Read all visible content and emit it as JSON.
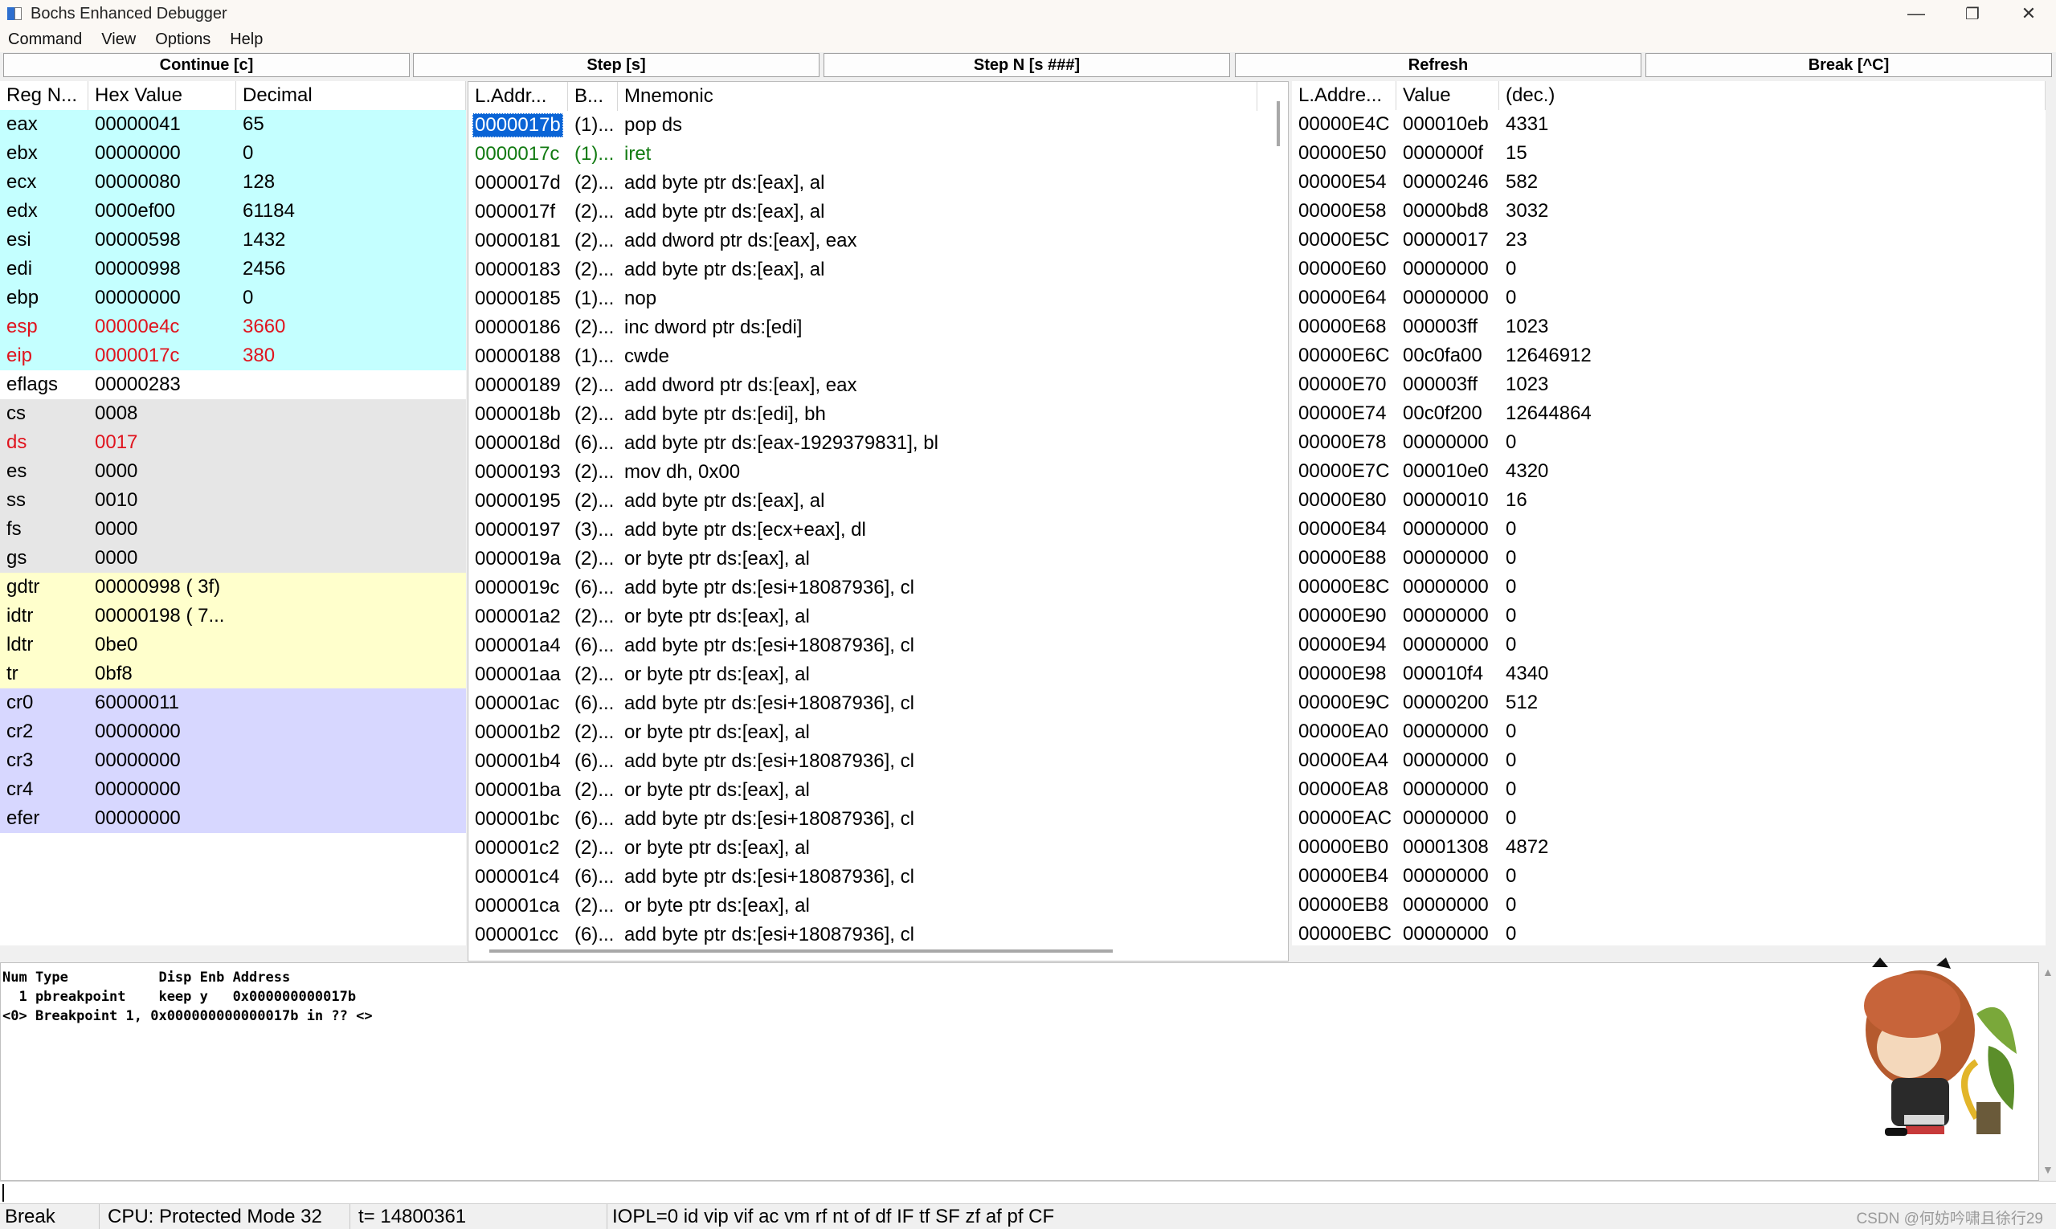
{
  "window": {
    "title": "Bochs Enhanced Debugger",
    "controls": {
      "minimize": "—",
      "restore": "❐",
      "close": "✕"
    }
  },
  "menu": [
    "Command",
    "View",
    "Options",
    "Help"
  ],
  "toolbar": {
    "continue": "Continue [c]",
    "step": "Step [s]",
    "step_n": "Step N [s ###]",
    "refresh": "Refresh",
    "break": "Break [^C]"
  },
  "registers": {
    "headers": [
      "Reg N...",
      "Hex Value",
      "Decimal"
    ],
    "rows": [
      {
        "name": "eax",
        "hex": "00000041",
        "dec": "65",
        "group": "gp",
        "changed": false
      },
      {
        "name": "ebx",
        "hex": "00000000",
        "dec": "0",
        "group": "gp",
        "changed": false
      },
      {
        "name": "ecx",
        "hex": "00000080",
        "dec": "128",
        "group": "gp",
        "changed": false
      },
      {
        "name": "edx",
        "hex": "0000ef00",
        "dec": "61184",
        "group": "gp",
        "changed": false
      },
      {
        "name": "esi",
        "hex": "00000598",
        "dec": "1432",
        "group": "gp",
        "changed": false
      },
      {
        "name": "edi",
        "hex": "00000998",
        "dec": "2456",
        "group": "gp",
        "changed": false
      },
      {
        "name": "ebp",
        "hex": "00000000",
        "dec": "0",
        "group": "gp",
        "changed": false
      },
      {
        "name": "esp",
        "hex": "00000e4c",
        "dec": "3660",
        "group": "gp",
        "changed": true
      },
      {
        "name": "eip",
        "hex": "0000017c",
        "dec": "380",
        "group": "gp",
        "changed": true
      },
      {
        "name": "eflags",
        "hex": "00000283",
        "dec": "",
        "group": "fl",
        "changed": false
      },
      {
        "name": "cs",
        "hex": "0008",
        "dec": "",
        "group": "seg",
        "changed": false
      },
      {
        "name": "ds",
        "hex": "0017",
        "dec": "",
        "group": "seg",
        "changed": true
      },
      {
        "name": "es",
        "hex": "0000",
        "dec": "",
        "group": "seg",
        "changed": false
      },
      {
        "name": "ss",
        "hex": "0010",
        "dec": "",
        "group": "seg",
        "changed": false
      },
      {
        "name": "fs",
        "hex": "0000",
        "dec": "",
        "group": "seg",
        "changed": false
      },
      {
        "name": "gs",
        "hex": "0000",
        "dec": "",
        "group": "seg",
        "changed": false
      },
      {
        "name": "gdtr",
        "hex": "00000998 ( 3f)",
        "dec": "",
        "group": "sys",
        "changed": false
      },
      {
        "name": "idtr",
        "hex": "00000198 ( 7...",
        "dec": "",
        "group": "sys",
        "changed": false
      },
      {
        "name": "ldtr",
        "hex": "0be0",
        "dec": "",
        "group": "sys",
        "changed": false
      },
      {
        "name": "tr",
        "hex": "0bf8",
        "dec": "",
        "group": "sys",
        "changed": false
      },
      {
        "name": "cr0",
        "hex": "60000011",
        "dec": "",
        "group": "cr",
        "changed": false
      },
      {
        "name": "cr2",
        "hex": "00000000",
        "dec": "",
        "group": "cr",
        "changed": false
      },
      {
        "name": "cr3",
        "hex": "00000000",
        "dec": "",
        "group": "cr",
        "changed": false
      },
      {
        "name": "cr4",
        "hex": "00000000",
        "dec": "",
        "group": "cr",
        "changed": false
      },
      {
        "name": "efer",
        "hex": "00000000",
        "dec": "",
        "group": "cr",
        "changed": false
      }
    ]
  },
  "disasm": {
    "headers": [
      "L.Addr...",
      "B...",
      "Mnemonic"
    ],
    "rows": [
      {
        "addr": "0000017b",
        "bytes": "(1)...",
        "mnem": "pop ds",
        "state": "selected"
      },
      {
        "addr": "0000017c",
        "bytes": "(1)...",
        "mnem": "iret",
        "state": "current"
      },
      {
        "addr": "0000017d",
        "bytes": "(2)...",
        "mnem": "add byte ptr ds:[eax], al",
        "state": ""
      },
      {
        "addr": "0000017f",
        "bytes": "(2)...",
        "mnem": "add byte ptr ds:[eax], al",
        "state": ""
      },
      {
        "addr": "00000181",
        "bytes": "(2)...",
        "mnem": "add dword ptr ds:[eax], eax",
        "state": ""
      },
      {
        "addr": "00000183",
        "bytes": "(2)...",
        "mnem": "add byte ptr ds:[eax], al",
        "state": ""
      },
      {
        "addr": "00000185",
        "bytes": "(1)...",
        "mnem": "nop",
        "state": ""
      },
      {
        "addr": "00000186",
        "bytes": "(2)...",
        "mnem": "inc dword ptr ds:[edi]",
        "state": ""
      },
      {
        "addr": "00000188",
        "bytes": "(1)...",
        "mnem": "cwde",
        "state": ""
      },
      {
        "addr": "00000189",
        "bytes": "(2)...",
        "mnem": "add dword ptr ds:[eax], eax",
        "state": ""
      },
      {
        "addr": "0000018b",
        "bytes": "(2)...",
        "mnem": "add byte ptr ds:[edi], bh",
        "state": ""
      },
      {
        "addr": "0000018d",
        "bytes": "(6)...",
        "mnem": "add byte ptr ds:[eax-1929379831], bl",
        "state": ""
      },
      {
        "addr": "00000193",
        "bytes": "(2)...",
        "mnem": "mov dh, 0x00",
        "state": ""
      },
      {
        "addr": "00000195",
        "bytes": "(2)...",
        "mnem": "add byte ptr ds:[eax], al",
        "state": ""
      },
      {
        "addr": "00000197",
        "bytes": "(3)...",
        "mnem": "add byte ptr ds:[ecx+eax], dl",
        "state": ""
      },
      {
        "addr": "0000019a",
        "bytes": "(2)...",
        "mnem": "or byte ptr ds:[eax], al",
        "state": ""
      },
      {
        "addr": "0000019c",
        "bytes": "(6)...",
        "mnem": "add byte ptr ds:[esi+18087936], cl",
        "state": ""
      },
      {
        "addr": "000001a2",
        "bytes": "(2)...",
        "mnem": "or byte ptr ds:[eax], al",
        "state": ""
      },
      {
        "addr": "000001a4",
        "bytes": "(6)...",
        "mnem": "add byte ptr ds:[esi+18087936], cl",
        "state": ""
      },
      {
        "addr": "000001aa",
        "bytes": "(2)...",
        "mnem": "or byte ptr ds:[eax], al",
        "state": ""
      },
      {
        "addr": "000001ac",
        "bytes": "(6)...",
        "mnem": "add byte ptr ds:[esi+18087936], cl",
        "state": ""
      },
      {
        "addr": "000001b2",
        "bytes": "(2)...",
        "mnem": "or byte ptr ds:[eax], al",
        "state": ""
      },
      {
        "addr": "000001b4",
        "bytes": "(6)...",
        "mnem": "add byte ptr ds:[esi+18087936], cl",
        "state": ""
      },
      {
        "addr": "000001ba",
        "bytes": "(2)...",
        "mnem": "or byte ptr ds:[eax], al",
        "state": ""
      },
      {
        "addr": "000001bc",
        "bytes": "(6)...",
        "mnem": "add byte ptr ds:[esi+18087936], cl",
        "state": ""
      },
      {
        "addr": "000001c2",
        "bytes": "(2)...",
        "mnem": "or byte ptr ds:[eax], al",
        "state": ""
      },
      {
        "addr": "000001c4",
        "bytes": "(6)...",
        "mnem": "add byte ptr ds:[esi+18087936], cl",
        "state": ""
      },
      {
        "addr": "000001ca",
        "bytes": "(2)...",
        "mnem": "or byte ptr ds:[eax], al",
        "state": ""
      },
      {
        "addr": "000001cc",
        "bytes": "(6)...",
        "mnem": "add byte ptr ds:[esi+18087936], cl",
        "state": ""
      }
    ]
  },
  "stack": {
    "headers": [
      "L.Addre...",
      "Value",
      "(dec.)"
    ],
    "rows": [
      {
        "addr": "00000E4C",
        "val": "000010eb",
        "dec": "4331"
      },
      {
        "addr": "00000E50",
        "val": "0000000f",
        "dec": "15"
      },
      {
        "addr": "00000E54",
        "val": "00000246",
        "dec": "582"
      },
      {
        "addr": "00000E58",
        "val": "00000bd8",
        "dec": "3032"
      },
      {
        "addr": "00000E5C",
        "val": "00000017",
        "dec": "23"
      },
      {
        "addr": "00000E60",
        "val": "00000000",
        "dec": "0"
      },
      {
        "addr": "00000E64",
        "val": "00000000",
        "dec": "0"
      },
      {
        "addr": "00000E68",
        "val": "000003ff",
        "dec": "1023"
      },
      {
        "addr": "00000E6C",
        "val": "00c0fa00",
        "dec": "12646912"
      },
      {
        "addr": "00000E70",
        "val": "000003ff",
        "dec": "1023"
      },
      {
        "addr": "00000E74",
        "val": "00c0f200",
        "dec": "12644864"
      },
      {
        "addr": "00000E78",
        "val": "00000000",
        "dec": "0"
      },
      {
        "addr": "00000E7C",
        "val": "000010e0",
        "dec": "4320"
      },
      {
        "addr": "00000E80",
        "val": "00000010",
        "dec": "16"
      },
      {
        "addr": "00000E84",
        "val": "00000000",
        "dec": "0"
      },
      {
        "addr": "00000E88",
        "val": "00000000",
        "dec": "0"
      },
      {
        "addr": "00000E8C",
        "val": "00000000",
        "dec": "0"
      },
      {
        "addr": "00000E90",
        "val": "00000000",
        "dec": "0"
      },
      {
        "addr": "00000E94",
        "val": "00000000",
        "dec": "0"
      },
      {
        "addr": "00000E98",
        "val": "000010f4",
        "dec": "4340"
      },
      {
        "addr": "00000E9C",
        "val": "00000200",
        "dec": "512"
      },
      {
        "addr": "00000EA0",
        "val": "00000000",
        "dec": "0"
      },
      {
        "addr": "00000EA4",
        "val": "00000000",
        "dec": "0"
      },
      {
        "addr": "00000EA8",
        "val": "00000000",
        "dec": "0"
      },
      {
        "addr": "00000EAC",
        "val": "00000000",
        "dec": "0"
      },
      {
        "addr": "00000EB0",
        "val": "00001308",
        "dec": "4872"
      },
      {
        "addr": "00000EB4",
        "val": "00000000",
        "dec": "0"
      },
      {
        "addr": "00000EB8",
        "val": "00000000",
        "dec": "0"
      },
      {
        "addr": "00000EBC",
        "val": "00000000",
        "dec": "0"
      }
    ]
  },
  "output": {
    "lines": [
      "Num Type           Disp Enb Address",
      "  1 pbreakpoint    keep y   0x000000000017b",
      "<0> Breakpoint 1, 0x000000000000017b in ?? <>"
    ]
  },
  "command_input": {
    "value": ""
  },
  "status": {
    "state": "Break",
    "cpu": "CPU: Protected Mode 32",
    "ticks": "t= 14800361",
    "flags": "IOPL=0 id vip vif ac vm rf nt of df IF tf SF zf af pf CF"
  },
  "watermark": "CSDN @何妨吟啸且徐行29",
  "colors": {
    "gp": "#c4ffff",
    "seg": "#e6e6e6",
    "sys": "#ffffcc",
    "cr": "#d7d7ff",
    "changed": "#e0141e",
    "current": "#117a11",
    "selected": "#0a64d6"
  },
  "icons": [
    "app-icon",
    "minimize-icon",
    "restore-icon",
    "close-icon",
    "scroll-up-arrow-icon",
    "scroll-down-arrow-icon",
    "mascot-sticker"
  ]
}
